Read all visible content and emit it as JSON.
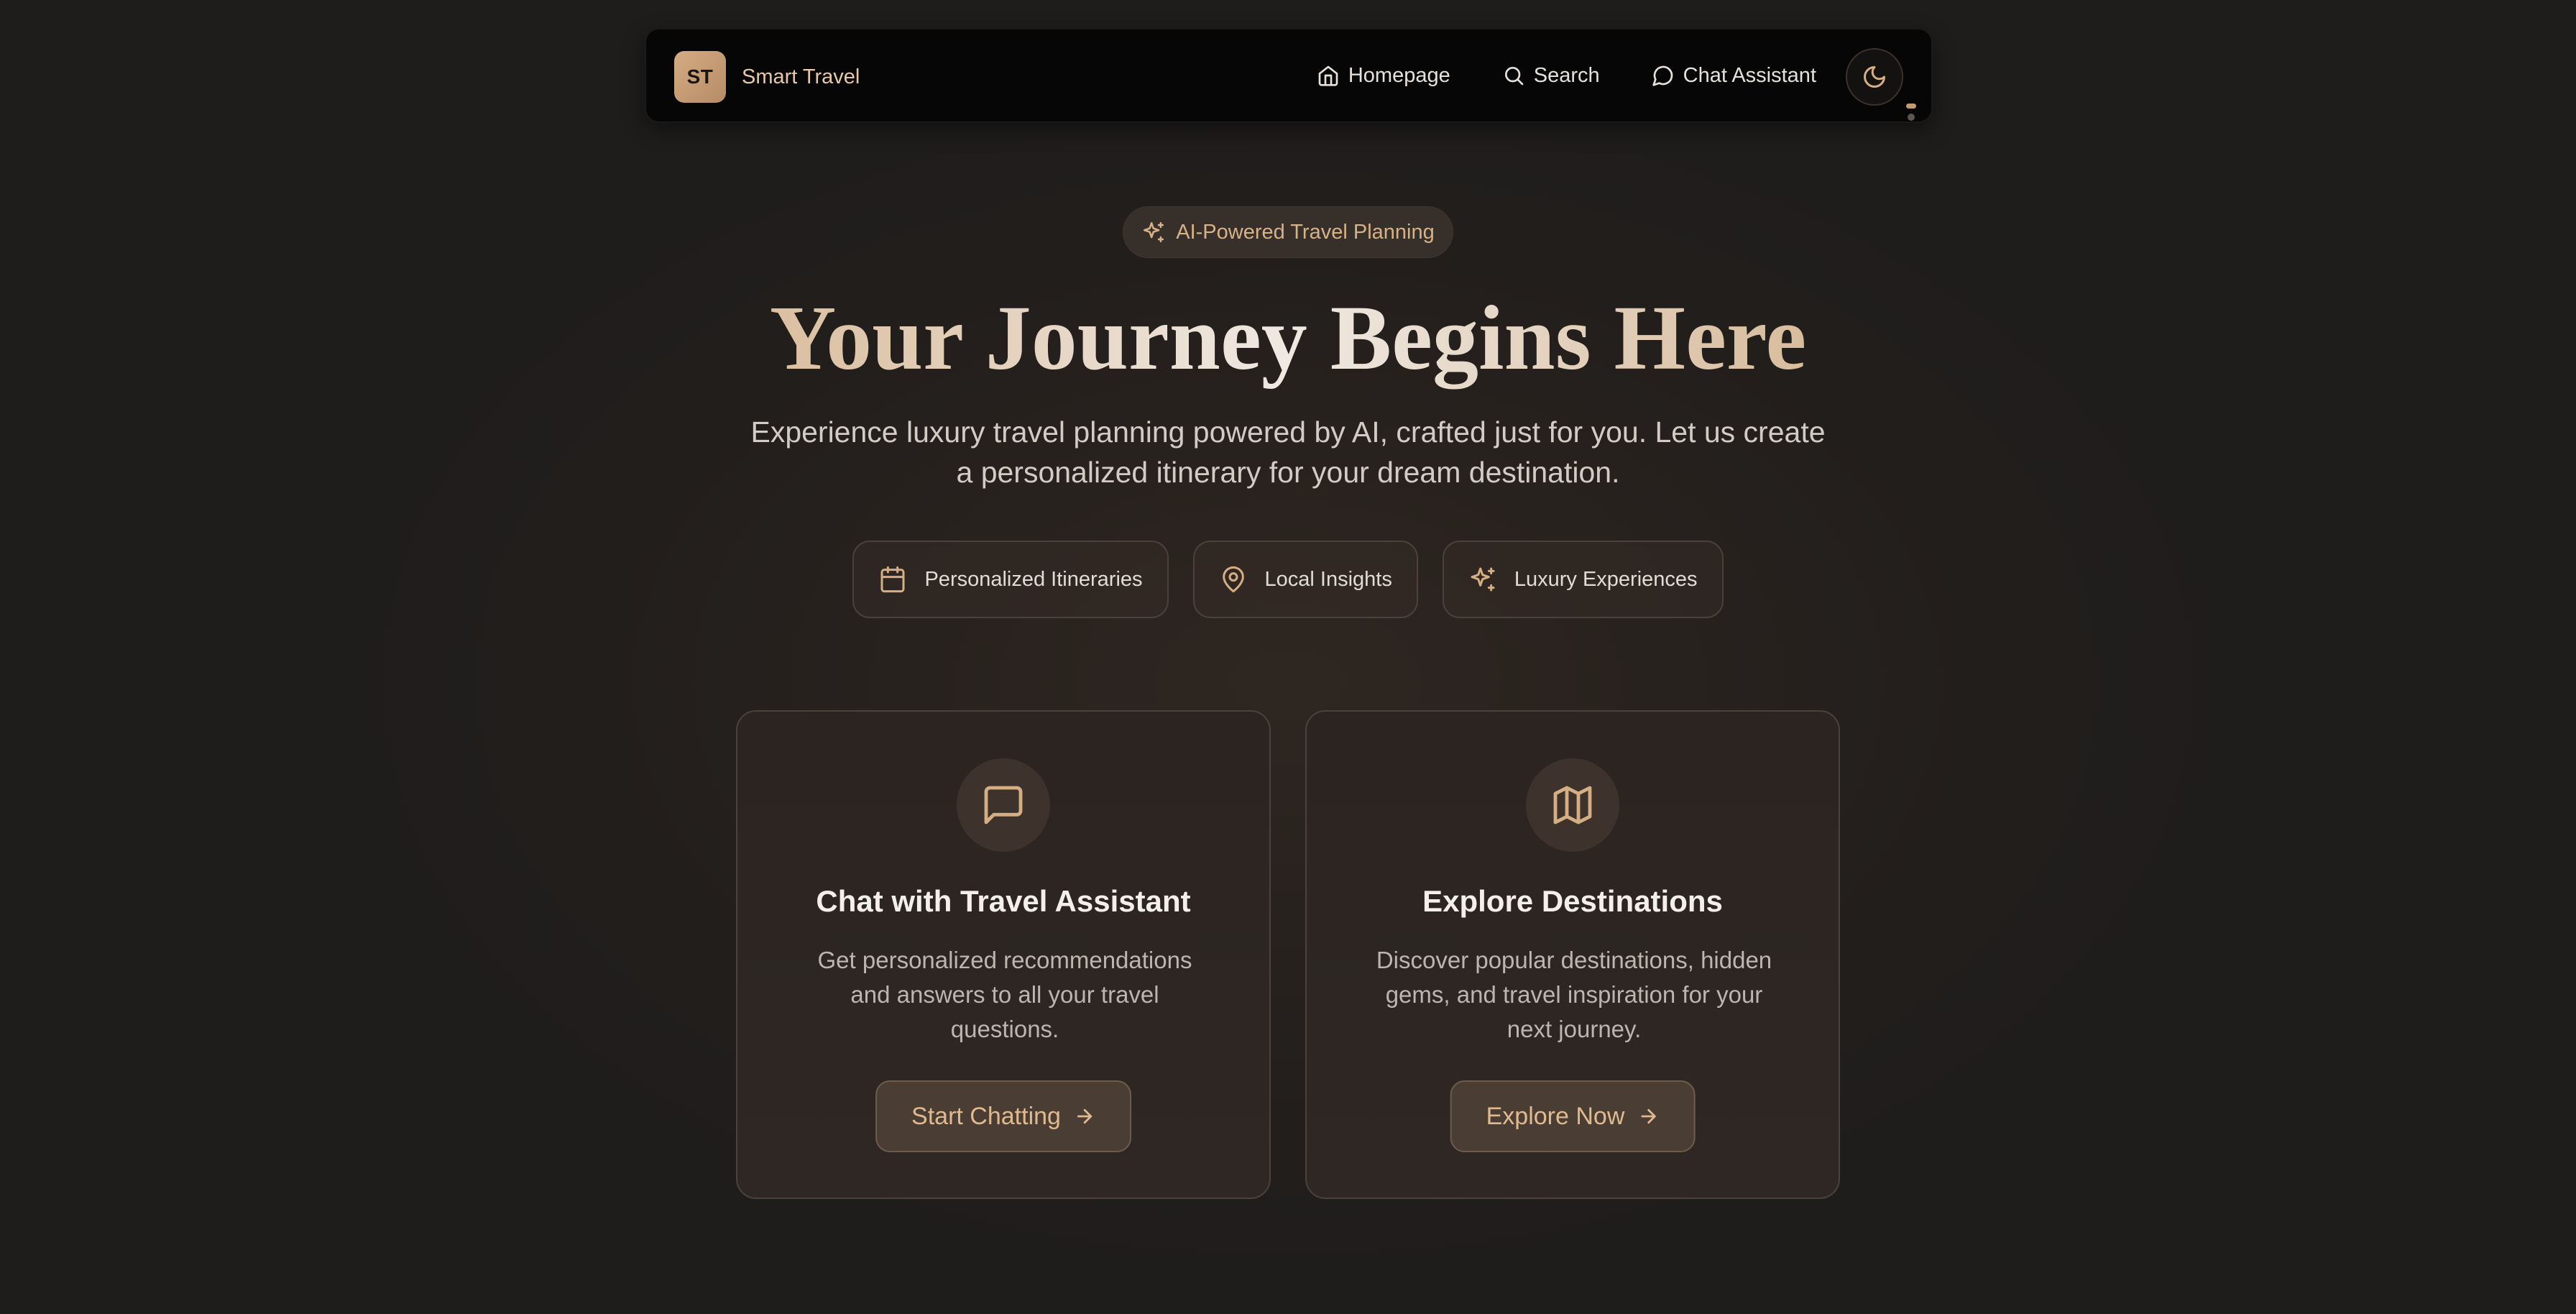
{
  "brand": {
    "logo_text": "ST",
    "name": "Smart Travel"
  },
  "nav": {
    "links": [
      {
        "label": "Homepage",
        "icon": "home-icon"
      },
      {
        "label": "Search",
        "icon": "search-icon"
      },
      {
        "label": "Chat Assistant",
        "icon": "message-circle-icon"
      }
    ],
    "theme_toggle_icon": "moon-icon"
  },
  "hero": {
    "badge": "AI-Powered Travel Planning",
    "title": "Your Journey Begins Here",
    "subtitle": "Experience luxury travel planning powered by AI, crafted just for you. Let us create a personalized itinerary for your dream destination.",
    "features": [
      {
        "label": "Personalized Itineraries",
        "icon": "calendar-icon"
      },
      {
        "label": "Local Insights",
        "icon": "map-pin-icon"
      },
      {
        "label": "Luxury Experiences",
        "icon": "sparkles-icon"
      }
    ]
  },
  "cards": [
    {
      "title": "Chat with Travel Assistant",
      "description": "Get personalized recommendations and answers to all your travel questions.",
      "button": "Start Chatting",
      "icon": "message-square-icon"
    },
    {
      "title": "Explore Destinations",
      "description": "Discover popular destinations, hidden gems, and travel inspiration for your next journey.",
      "button": "Explore Now",
      "icon": "map-icon"
    }
  ],
  "colors": {
    "accent": "#d6ae84",
    "background": "#221e1c",
    "nav_background": "#070606",
    "card_background": "#2c2521"
  }
}
